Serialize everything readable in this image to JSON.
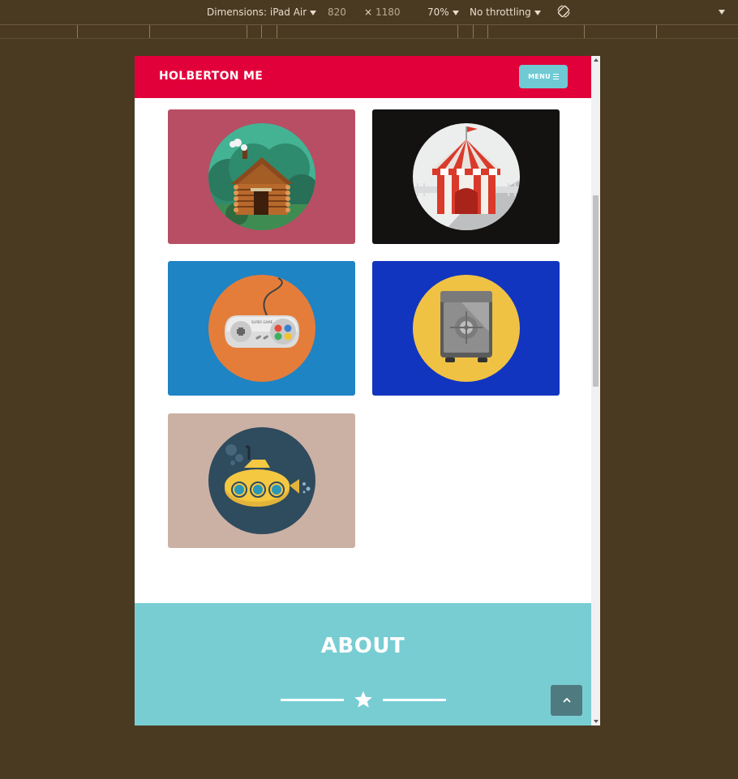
{
  "devtools": {
    "dimensions_label": "Dimensions: iPad Air",
    "width": "820",
    "times": "×",
    "height": "1180",
    "zoom": "70%",
    "throttling": "No throttling"
  },
  "navbar": {
    "brand": "HOLBERTON ME",
    "menu_label": "MENU"
  },
  "portfolio": {
    "items": [
      {
        "name": "cabin",
        "bg": "#b84e64"
      },
      {
        "name": "circus-tent",
        "bg": "#141211"
      },
      {
        "name": "game-controller",
        "bg": "#1e84c4"
      },
      {
        "name": "safe",
        "bg": "#1235bf"
      },
      {
        "name": "submarine",
        "bg": "#cbb1a4"
      }
    ],
    "controller_text": "SUPER GAME"
  },
  "about": {
    "title": "ABOUT"
  },
  "colors": {
    "navbar": "#e2003b",
    "accent": "#78cdd3",
    "scroll_top": "#4f7a80"
  },
  "icons": [
    "menu-icon",
    "star-icon",
    "chevron-up-icon",
    "rotate-icon"
  ]
}
